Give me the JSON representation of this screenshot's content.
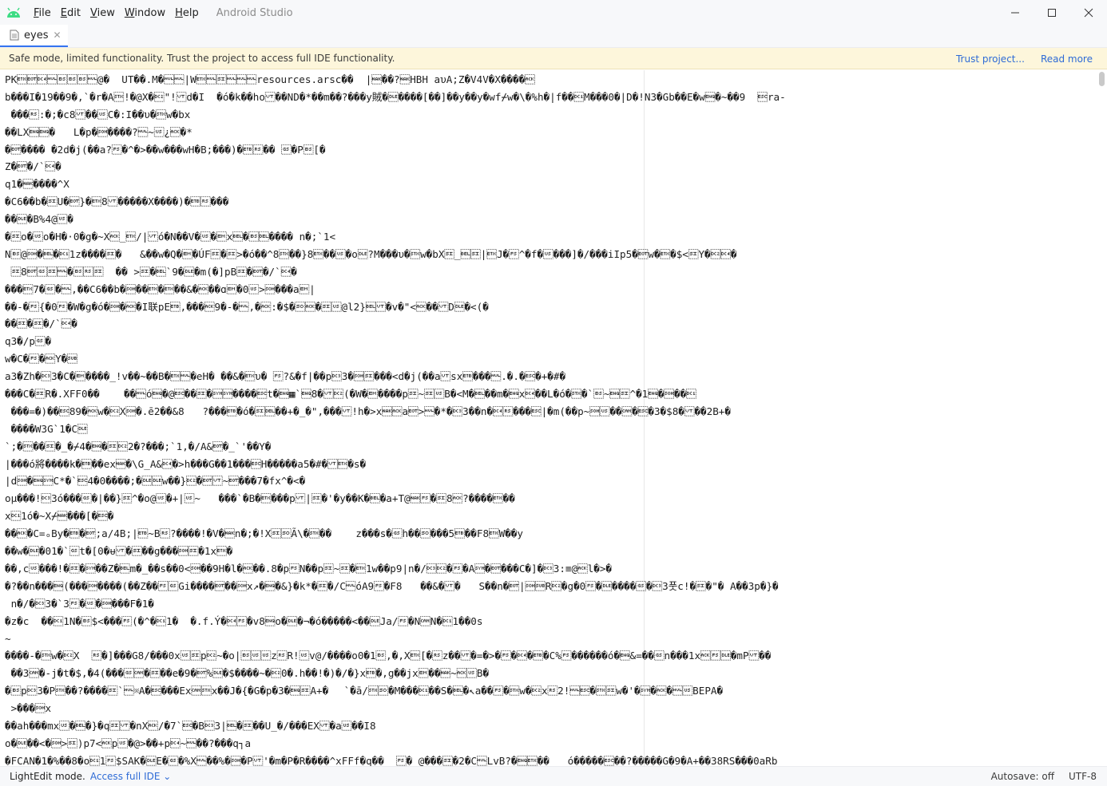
{
  "titlebar": {
    "menu": [
      "File",
      "Edit",
      "View",
      "Window",
      "Help"
    ],
    "title": "Android Studio"
  },
  "tabs": [
    {
      "label": "eyes"
    }
  ],
  "banner": {
    "text": "Safe mode, limited functionality. Trust the project to access full IDE functionality.",
    "trust_link": "Trust project...",
    "read_more": "Read more"
  },
  "editor": {
    "lines": [
      "PK\u0003\u0004\u0014\u0000\b\b\b\u0000@�  UT��.M�\u0000\u0000|W\u0003\u0000\u000f\u0000\u0000\u0000resources.arsc��  |\u0015��?\u0015HBH aυA;Z�V4V�X����\u0006",
      "b���I�19��9�,`�r�A\u0002!�@X�\u0012\"!\u000bd�I  �ó�k��ho\u000b��ND�*��m��?���y賊�\u0010����[��]��y��y�wf⌿w�\\�%h�|f��\u0011M���0�|D�!N3�Gb��E�w\u0005�~��9  \u001bra-",
      " �\f��\u001e:�;�c8\u000b��\u001fC�:I��υ�\u0002w�bx",
      "��LX\u0005\u0005�   L�p�\u0001����?\u0000~\u001f¿\u0006�*",
      "�\u0004���� �2d�j(��a?\u001c�^�>��w���wH�B;���)�\u0017\u001e�� \u001d�P\b[�",
      "Z�\u0004\f�/`\u0014�",
      "q1�\u0015����^X",
      "�C6��b�\u000fU�\u0004}�\u00038\u000b�����X����)�\u0017\u001e���",
      "��\u0010�B%4@\u001f�",
      "�\u000fo�\u001fo�H�·0�g�~X\u0006_\u0003/|\u000bó�N��V�\u001f�\u0019x\u0007�\b���� n�;`1<",
      "N\b@\u0001�\f\u0007�\u00111z����\u000f�   &��w�Q�\u0019�ÚF\u000f�\u000f>�ó��^8\u0002��}8\u0003��\u001f�o\u0010?M���υ�\u0002w�bX\u000f_\u0007\u000f|\u0003J�\u001c^�f�\u001f���]�/���iIp5�\u0004w�\u0003�$<\u000fY�\u0012\u0014�",
      " \u000f8\u0004\u001d\u000f\u0000�\b\u001e\u000f  �� >\u000f�\u0007`9�\u0010�m(�]pB\u000f�\u0004\f�/`\u0014�",
      "���\u00037�\u001d�\u0000,��C6��b�\u0001��\u0003�\u0003��&�\u0006�\f�ɑ\u0019�0\u001f>\u0001���a\u0019|",
      "��-�\u001c{�0\u001c�W�g�ó�\u0001�\u0006�I联pE\u0017,���\u00069�-�\u0000,�\u0006:�$�\u000e\u0006�\u000f\u001f@l2}\u0007\u000b�v�\"<\u0006��\u000bD\u0010�<(�",
      "��\u000f�\u000f\f�/`\u0014�",
      "q3�/p\u001d�",
      "w�C�\u001c�\u0006Y�\u001a",
      "a3�Zh�\u00133�C�\u0019����_!v��~��B�\u0003\u0000�eH� ��&�\u0003υ� \u001c?&�f|��p\u00133�\u0001\u000f���<d�j(��a\u000bsx\u0017���\u0000.�.\f�\u001b�+�#�",
      "���C�\u000fR�.XFF0��    ��\u0000ó\u0005�@\u001b��\u000f�\u0016\u0016����\u001bt�\u0005▦`\u00058�\u000b\u0012(�W�\u0019����p\u000f~\u000f\u001fB�<M�\u0007��m�\u0005x\u0014��L�ó�\u0002�`\b~\u0005\u000f^�1\u0005�\u0001��\u0011",
      " ���=�)��\u001b89�\u0006w�\u0012X\u0001�.ē2��&8   ?���\u0017�ó�\u000f��+�_�\",���\u000b!h�>x\u0015\u0006a\u0004>\u0000�*�\u00133��n�\u0014\u001e���\u001b|�m(��p\f~\u0001\u001f��\u0018�\u001b�3�$8�\u000b��2B+�",
      " ����W3G`1�C\u0010",
      "`;�\u0002��\u000f�_�⌿4�\u0005�\u000f\u00122�?���;`1,�/A&\u0004�_`'��Y�",
      "|���ó將����k�\u0017��ex\u0015�\\G_A&\u0014�>h���G��1���\u001bH�����a5�#�\u000b\u0003�s�",
      "|d\u0001�\u0005\u0016C*�`\u001b4�0����;�\u0010\u0010w��}\u0012�\u0004\u000b~\u0004���7�fx\f^�<�",
      "oµ���!\u00133ó���\u001d�|��}\u000f^�o@\u001f�+|\u001f~   ���`�B�\u0003���p\u000b|\u000f�'�y��K�\u0007�a+T@\u0015\u001c�\u000f8\u0006?����\u0003��",
      "x\u00111ó�~X⌿\u0015���[�\u001b�",
      "��\u0006�C=ₒBy�\u0017�\u0004;a/4B;|\u0017~B\u001e?����!�V�\u0015n�;�!X\u000f\u000eÃ\\�\u0002��    z���s�\u001dh��\u000e���5\u0017��F8\u0003W��y",
      "��w�\u0010�01�`\u001dt�[0�ᵾ\u000b�\u000f��g���\u0001\u000f�1x\u0003�",
      "��,c\u001f���!�\u000f�\u0016��Z�\u0007m�_��s��0<\u0001��9H�l�\u0006��.8\f�p\u001cN��p\u000f~\u000f�\u00031w��p9|\fn�/\u0013\u0012�\u001c�A\u0016�\u0004���C�]�\u00133:≡@\u0006l�>�",
      "�?��n���\u0005(���\u0001����(��Z\f��\u001c\u001dGi����\u0004��\u0001x↗�\u0005�&}�k*�\u000f�/C\u0000óA9\u001c�F8   ��&�\u000b�   S��n�\u0004|\u0001\u001aR\u0012�g�0\u001c�\u0010����\u001d�\u00133풋c!�\u000f�\"� A��3p�}�",
      " \fn�/�\u00133�`3\u001c�\u001f�\u0001���F�1�",
      "�z�c  ��\u00111N�\b$<���\u001c(�^�\u00111�  �.f.Ý�\u0014\u001c�v8\u0005o�\u0010�¬�ó�����<��\u0010Ja/\u001c�N\u0018N�\u00111��0s",
      "~",
      "����-�\u0002w�\u0012X  \u001e�]���G8/���0x\u001f\u000fp\u0012~�o|\b\u001f\u001fz\u001eR!\u001fv@/����o0�1\b,�,X\u0003[�\u001ez��\u000b�=�>�\u001c�\u0014�\u0017�C%\u001c������ó�\u0005&=��\u001dn���1x\u0006\u001c\u0010�mP\u000b��",
      " ��3\u0018�-j�t�$,�4(���\u001d\u0018�\u000f��e�9�\u0004%\u0010�$����~�\u00120�.h��!�)�/�}x\u0017�,g��jx\u0019��\u0015~\u0006\u001fB�",
      "�\bp\u00133�P\u0002��\f?����\u000f`\u0000※A�\u001b���Ex\u0018\u0002x��J�{�G�p�3�\u0005\u000fA+�\t`�ā/\u0002\u000e�M���\u0011��S�\u0007\f�↖a��\u001c�\u0002w�\u0012x\u001e2!\u0000\u001b�\u0002\u000fw�'�\u0016�\u0006�\u0000\u001fBEPA�",
      " >���\u0001x",
      "��ah���mx\u001f�\u0007�}�q\u000f\u000b�nX\u0006/�7`\u001b�B\u00133|\u0007�\u000f��U_�/�\f��EX\u000b�a\u001f��I8",
      "o�\u0010��<�\u0001>\u000f)p7<\u0006p\u001f�@>��+p\u0014~\u0000��?���q┐a",
      "�FCAN�1�%��8�o\u00111\u001c$SAK�\u0010E�\u001d�%X\u0000��%�\u0001�P\u000b'�m�P�R����^xFFf�q��  \u001c� @���\u000f�2�C\u0000LvB?�\u0005\u0003��   ó�����\u001b��?�����G�9�A+��38RS���0aRb"
    ]
  },
  "status": {
    "mode": "LightEdit mode.",
    "access": "Access full IDE",
    "autosave": "Autosave: off",
    "encoding": "UTF-8"
  }
}
